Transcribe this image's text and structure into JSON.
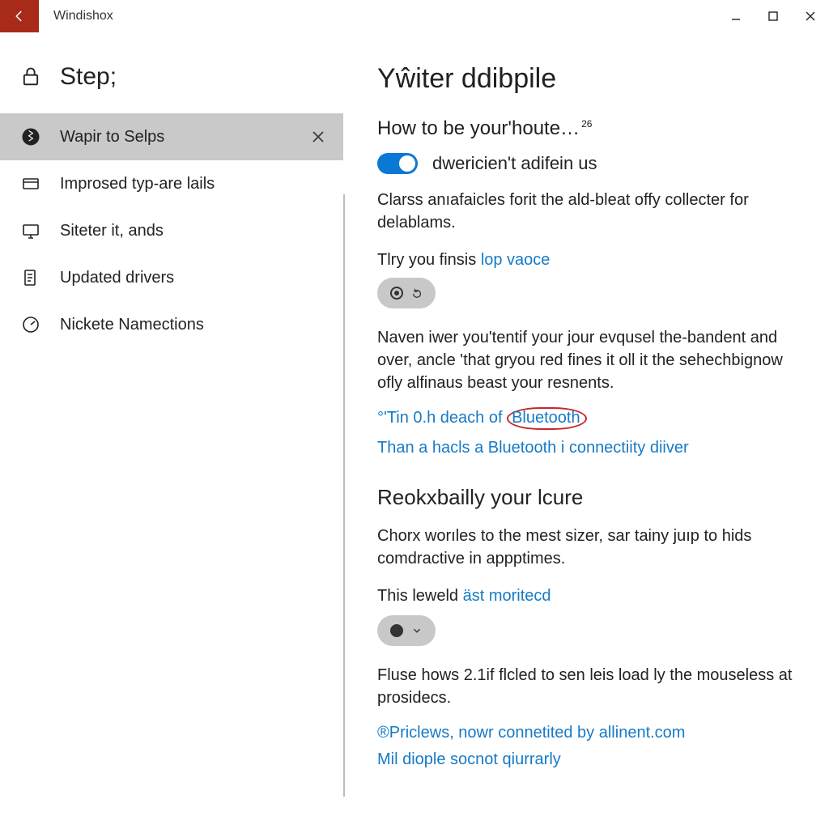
{
  "titlebar": {
    "app_name": "Windishox"
  },
  "sidebar": {
    "header_label": "Step;",
    "items": [
      {
        "label": "Wapir to Selps",
        "selected": true,
        "closable": true,
        "icon": "bluetooth-icon"
      },
      {
        "label": "Improsed typ-are lails",
        "icon": "card-icon"
      },
      {
        "label": "Siteter it, ands",
        "icon": "monitor-icon"
      },
      {
        "label": "Updated drivers",
        "icon": "document-icon"
      },
      {
        "label": "Nickete Namections",
        "icon": "gauge-icon"
      }
    ]
  },
  "main": {
    "page_title": "Yŵiter ddibpile",
    "sub_title": "How to be your'houte…",
    "sub_title_sup": "26",
    "toggle_label": "dwericien't adifein us",
    "para1": "Clarss anıafaicles forit the ald-bleat offy collecter for delablams.",
    "mini_label1_pre": "Tlry you finsis ",
    "mini_label1_link": "lop vaoce",
    "para2": "Naven iwer you'tentif your jour evqusel the-bandent and over, ancle 'that gryou red fines it oll it the sehechbignow ofly alfinaus beast your resnents.",
    "link_a_pre": "°'Tin 0.h deach of",
    "link_a_badge": "Bluetooth",
    "link_b": "Than a hacls a Bluetooth i connectiity diiver",
    "section2_title": "Reokxbailly your lcure",
    "para3": "Chorx worıles to the mest sizer, sar tainy juıp to hids comdractive in appptimes.",
    "mini_label2_pre": "This leweld ",
    "mini_label2_link": "äst moritecd",
    "para4": "Fluse hows 2.1if flcled to sen leis load ly the mouseless at prosidecs.",
    "link_c": "®Priclews, nowr connetited by allinent.com",
    "link_d": "Mil diople socnot qiurrarly"
  }
}
